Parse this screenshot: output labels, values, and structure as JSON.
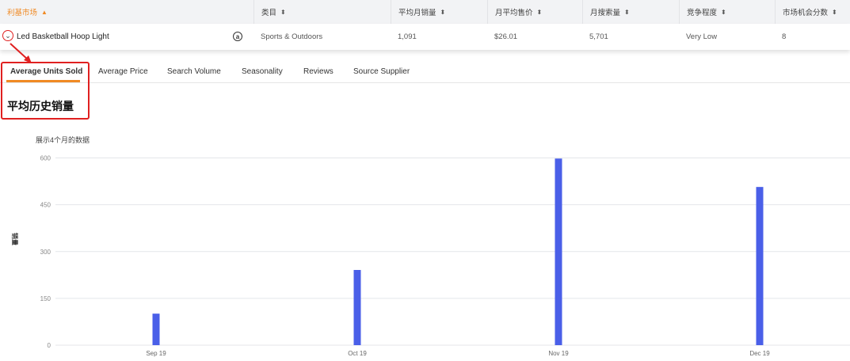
{
  "table": {
    "headers": [
      "利基市场",
      "类目",
      "平均月销量",
      "月平均售价",
      "月搜索量",
      "竞争程度",
      "市场机会分数"
    ],
    "sort_asc_icon": "▲",
    "sort_icon": "⬍",
    "row": {
      "product": "Led Basketball Hoop Light",
      "category": "Sports & Outdoors",
      "avg_monthly_sales": "1,091",
      "avg_price": "$26.01",
      "search_volume": "5,701",
      "competition": "Very Low",
      "opportunity_score": "8"
    }
  },
  "tabs": [
    "Average Units Sold",
    "Average Price",
    "Search Volume",
    "Seasonality",
    "Reviews",
    "Source Supplier"
  ],
  "active_tab": "Average Units Sold",
  "section_title": "平均历史销量",
  "colors": {
    "accent": "#f08a24",
    "bar": "#4a5fe8",
    "annotation": "#e02020"
  },
  "chart_data": {
    "type": "bar",
    "subtitle": "展示4个月的数据",
    "ylabel": "销量",
    "categories": [
      "Sep 19",
      "Oct 19",
      "Nov 19",
      "Dec 19"
    ],
    "values": [
      101,
      241,
      598,
      507
    ],
    "ylim": [
      0,
      600
    ],
    "yticks": [
      0,
      150,
      300,
      450,
      600
    ],
    "grid": true
  }
}
